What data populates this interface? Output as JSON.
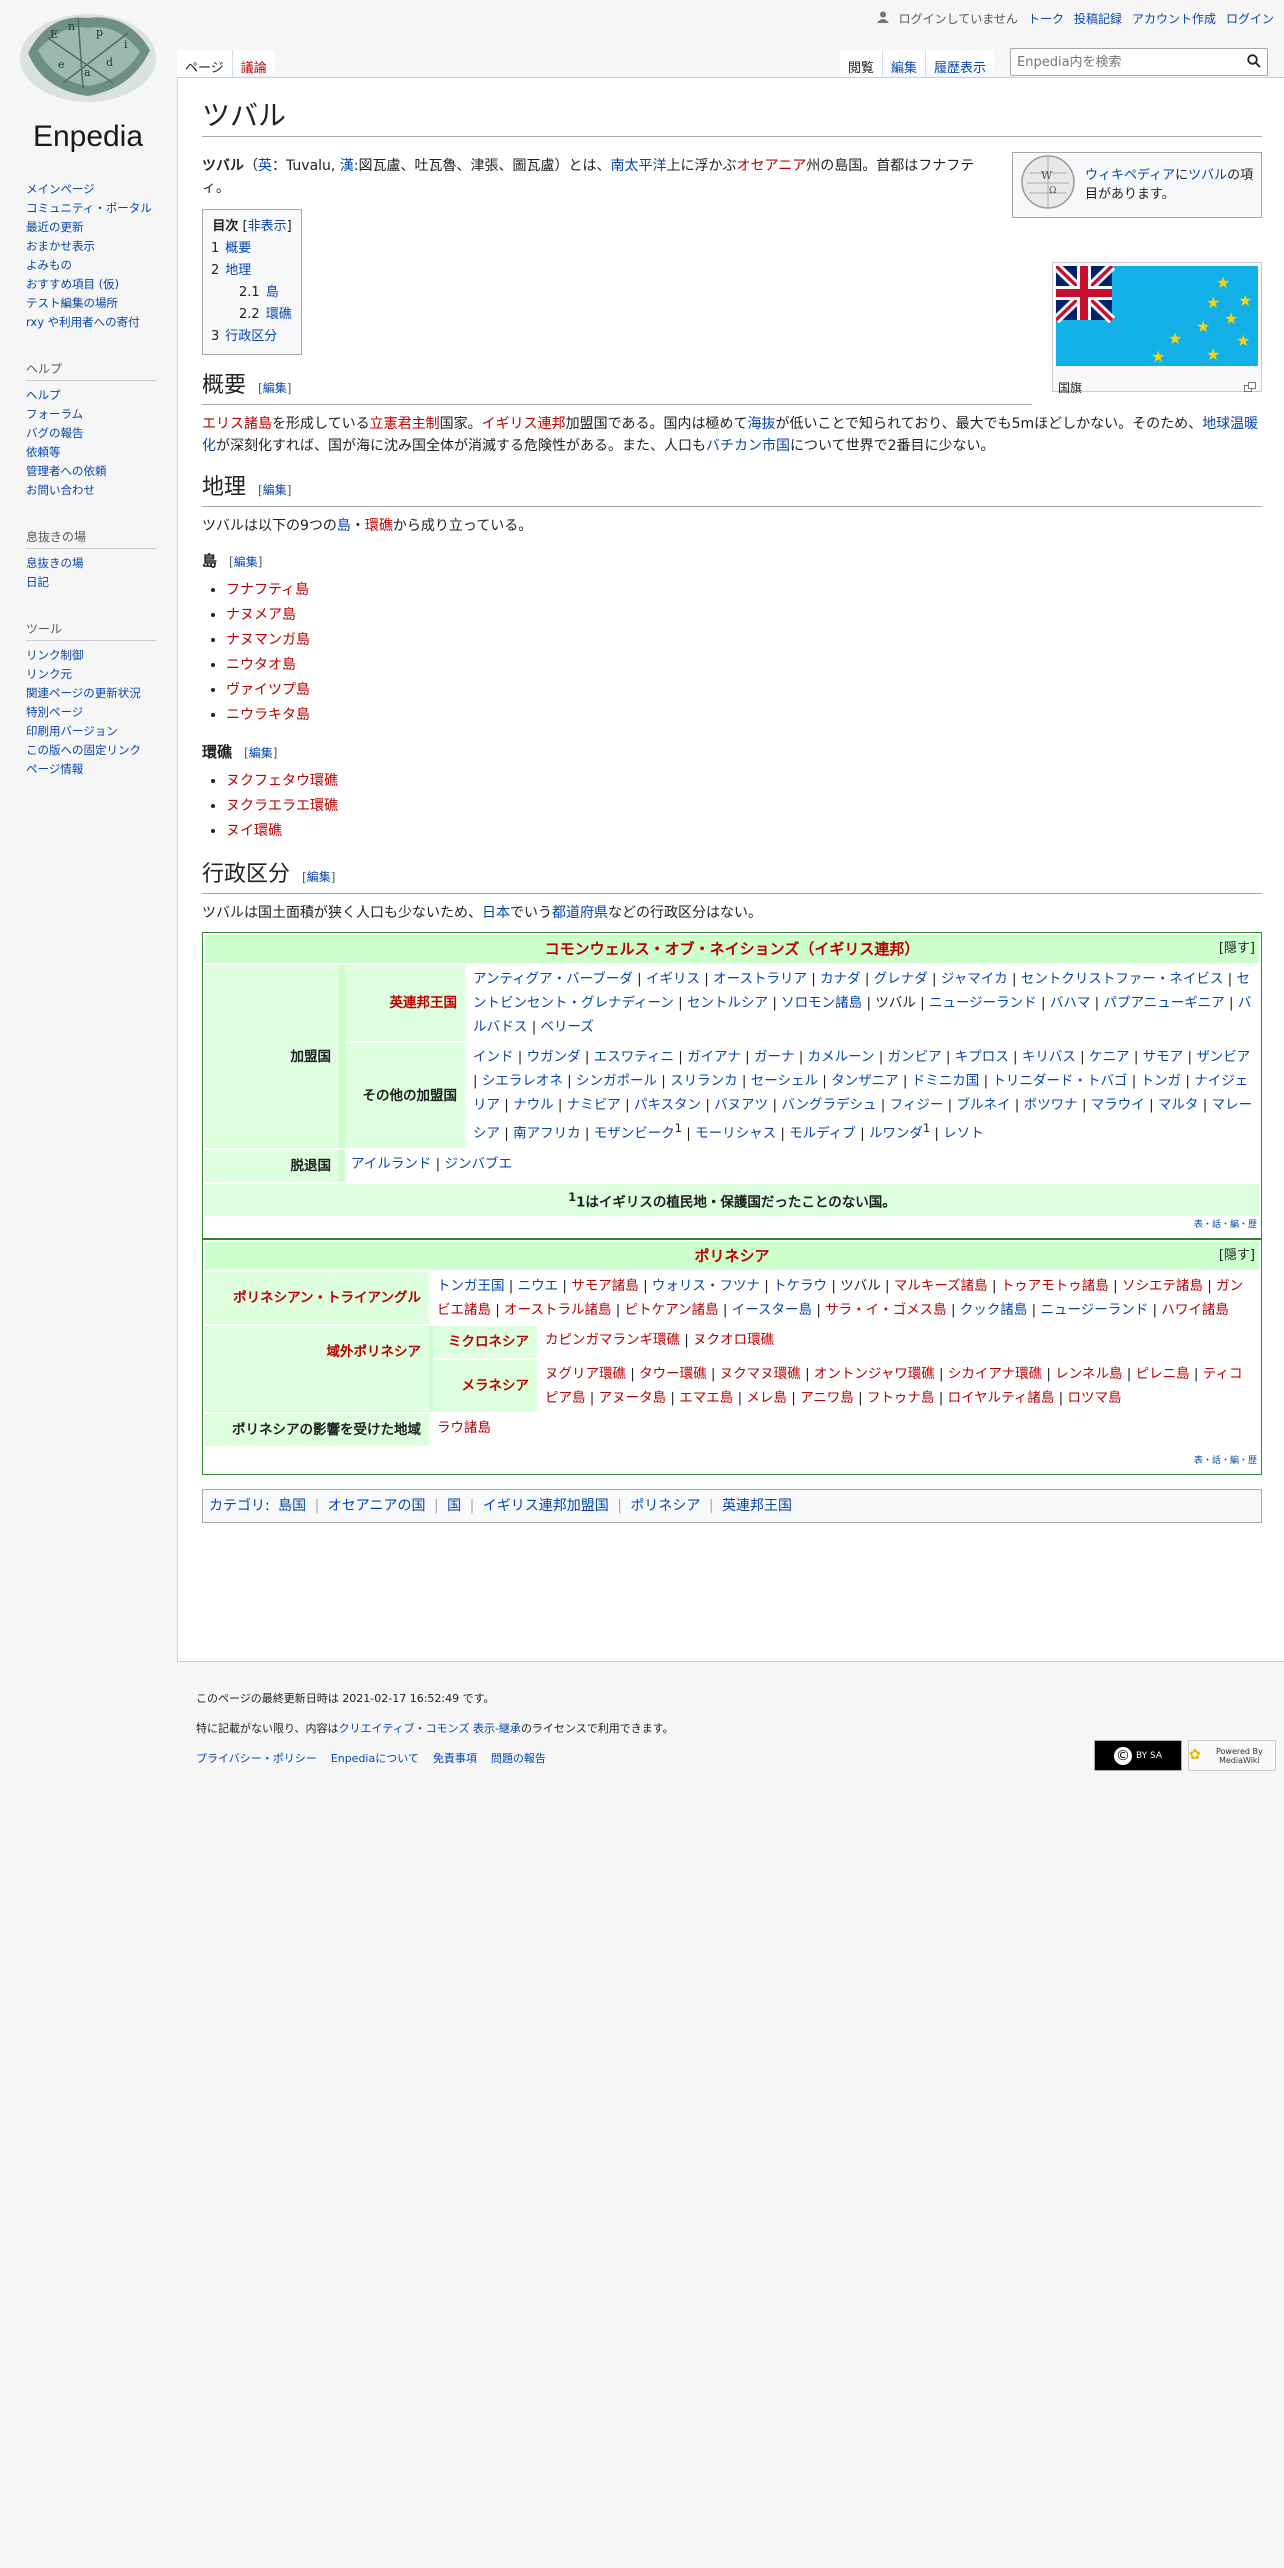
{
  "site": {
    "logo_text": "Enpedia",
    "logo_leaf_letters": [
      "E",
      "n",
      "p",
      "e",
      "d",
      "i",
      "a"
    ]
  },
  "personal": {
    "not_logged_in": "ログインしていません",
    "talk": "トーク",
    "contribs": "投稿記録",
    "create_account": "アカウント作成",
    "login": "ログイン"
  },
  "tabs": {
    "page": "ページ",
    "discussion": "議論",
    "read": "閲覧",
    "edit": "編集",
    "history": "履歴表示"
  },
  "search": {
    "placeholder": "Enpedia内を検索"
  },
  "sidebar": {
    "main": [
      "メインページ",
      "コミュニティ・ポータル",
      "最近の更新",
      "おまかせ表示",
      "よみもの",
      "おすすめ項目 (仮)",
      "テスト編集の場所",
      "rxy や利用者への寄付"
    ],
    "help_title": "ヘルプ",
    "help": [
      "ヘルプ",
      "フォーラム",
      "バグの報告",
      "依頼等",
      "管理者への依頼",
      "お問い合わせ"
    ],
    "rest_title": "息抜きの場",
    "rest": [
      "息抜きの場",
      "日記"
    ],
    "tools_title": "ツール",
    "tools": [
      "リンク元",
      "関連ページの更新状況",
      "特別ページ",
      "印刷用バージョン",
      "この版への固定リンク",
      "ページ情報"
    ],
    "tools_first": "リンク制御"
  },
  "article": {
    "title": "ツバル",
    "wp_box": {
      "pre": "",
      "link1": "ウィキペディア",
      "mid": "に",
      "link2": "ツバル",
      "post": "の項目があります。"
    },
    "flag_caption": "国旗",
    "intro": {
      "bold": "ツバル",
      "p1": "（",
      "en": "英",
      "p2": "：Tuvalu, ",
      "han": "漢",
      "p3": ":図瓦盧、吐瓦魯、津張、圖瓦盧）とは、",
      "pacific": "南太平洋",
      "p4": "上に浮かぶ",
      "oceania": "オセアニア",
      "p5": "州の島国。首都はフナフティ。"
    },
    "toc": {
      "title": "目次",
      "toggle": "非表示",
      "items": [
        {
          "num": "1",
          "label": "概要"
        },
        {
          "num": "2",
          "label": "地理"
        },
        {
          "num": "2.1",
          "label": "島"
        },
        {
          "num": "2.2",
          "label": "環礁"
        },
        {
          "num": "3",
          "label": "行政区分"
        }
      ]
    },
    "edit_label": "編集",
    "s1": {
      "heading": "概要",
      "t1": "エリス諸島",
      "t2": "を形成している",
      "t3": "立憲君主制",
      "t4": "国家。",
      "t5": "イギリス連邦",
      "t6": "加盟国である。国内は極めて",
      "t7": "海抜",
      "t8": "が低いことで知られており、最大でも5mほどしかない。そのため、",
      "t9": "地球温暖化",
      "t10": "が深刻化すれば、国が海に沈み国全体が消滅する危険性がある。また、人口も",
      "t11": "バチカン市国",
      "t12": "について世界で2番目に少ない。"
    },
    "s2": {
      "heading": "地理",
      "t1": "ツバルは以下の9つの",
      "t2": "島",
      "t3": "・",
      "t4": "環礁",
      "t5": "から成り立っている。"
    },
    "islands": {
      "heading": "島",
      "items": [
        "フナフティ島",
        "ナヌメア島",
        "ナヌマンガ島",
        "ニウタオ島",
        "ヴァイツプ島",
        "ニウラキタ島"
      ]
    },
    "atolls": {
      "heading": "環礁",
      "items": [
        "ヌクフェタウ環礁",
        "ヌクラエラエ環礁",
        "ヌイ環礁"
      ]
    },
    "s3": {
      "heading": "行政区分",
      "t1": "ツバルは国土面積が狭く人口も少ないため、",
      "t2": "日本",
      "t3": "でいう",
      "t4": "都道府県",
      "t5": "などの行政区分はない。"
    }
  },
  "navbox1": {
    "title": "コモンウェルス・オブ・ネイションズ（イギリス連邦）",
    "hide": "[隠す]",
    "member_label": "加盟国",
    "realm_label": "英連邦王国",
    "realms": [
      [
        "アンティグア・バーブーダ",
        "b"
      ],
      [
        "イギリス",
        "b"
      ],
      [
        "オーストラリア",
        "b"
      ],
      [
        "カナダ",
        "b"
      ],
      [
        "グレナダ",
        "b"
      ],
      [
        "ジャマイカ",
        "b"
      ],
      [
        "セントクリストファー・ネイビス",
        "b"
      ],
      [
        "セントビンセント・グレナディーン",
        "b"
      ],
      [
        "セントルシア",
        "b"
      ],
      [
        "ソロモン諸島",
        "b"
      ],
      [
        "ツバル",
        "p"
      ],
      [
        "ニュージーランド",
        "b"
      ],
      [
        "バハマ",
        "b"
      ],
      [
        "パプアニューギニア",
        "b"
      ],
      [
        "バルバドス",
        "b"
      ],
      [
        "ベリーズ",
        "b"
      ]
    ],
    "others_label": "その他の加盟国",
    "others": [
      [
        "インド",
        "b"
      ],
      [
        "ウガンダ",
        "b"
      ],
      [
        "エスワティニ",
        "b"
      ],
      [
        "ガイアナ",
        "b"
      ],
      [
        "ガーナ",
        "b"
      ],
      [
        "カメルーン",
        "b"
      ],
      [
        "ガンビア",
        "b"
      ],
      [
        "キプロス",
        "b"
      ],
      [
        "キリバス",
        "b"
      ],
      [
        "ケニア",
        "b"
      ],
      [
        "サモア",
        "b"
      ],
      [
        "ザンビア",
        "b"
      ],
      [
        "シエラレオネ",
        "b"
      ],
      [
        "シンガポール",
        "b"
      ],
      [
        "スリランカ",
        "b"
      ],
      [
        "セーシェル",
        "b"
      ],
      [
        "タンザニア",
        "b"
      ],
      [
        "ドミニカ国",
        "b"
      ],
      [
        "トリニダード・トバゴ",
        "b"
      ],
      [
        "トンガ",
        "b"
      ],
      [
        "ナイジェリア",
        "b"
      ],
      [
        "ナウル",
        "b"
      ],
      [
        "ナミビア",
        "b"
      ],
      [
        "パキスタン",
        "b"
      ],
      [
        "バヌアツ",
        "b"
      ],
      [
        "バングラデシュ",
        "b"
      ],
      [
        "フィジー",
        "b"
      ],
      [
        "ブルネイ",
        "b"
      ],
      [
        "ボツワナ",
        "b"
      ],
      [
        "マラウイ",
        "b"
      ],
      [
        "マルタ",
        "b"
      ],
      [
        "マレーシア",
        "b"
      ],
      [
        "南アフリカ",
        "b"
      ],
      [
        "モザンビーク",
        "b",
        "1"
      ],
      [
        "モーリシャス",
        "b"
      ],
      [
        "モルディブ",
        "b"
      ],
      [
        "ルワンダ",
        "b",
        "1"
      ],
      [
        "レソト",
        "b"
      ]
    ],
    "withdrawn_label": "脱退国",
    "withdrawn": [
      [
        "アイルランド",
        "b"
      ],
      [
        "ジンバブエ",
        "b"
      ]
    ],
    "footnote": "1はイギリスの植民地・保護国だったことのない国。",
    "footnote_sup": "1",
    "vte": "表・話・編・歴"
  },
  "navbox2": {
    "title": "ポリネシア",
    "hide": "[隠す]",
    "tri_label": "ポリネシアン・トライアングル",
    "tri": [
      [
        "トンガ王国",
        "b"
      ],
      [
        "ニウエ",
        "b"
      ],
      [
        "サモア諸島",
        "r"
      ],
      [
        "ウォリス・フツナ",
        "b"
      ],
      [
        "トケラウ",
        "b"
      ],
      [
        "ツバル",
        "p"
      ],
      [
        "マルキーズ諸島",
        "r"
      ],
      [
        "トゥアモトゥ諸島",
        "r"
      ],
      [
        "ソシエテ諸島",
        "r"
      ],
      [
        "ガンビエ諸島",
        "r"
      ],
      [
        "オーストラル諸島",
        "r"
      ],
      [
        "ピトケアン諸島",
        "r"
      ],
      [
        "イースター島",
        "b"
      ],
      [
        "サラ・イ・ゴメス島",
        "r"
      ],
      [
        "クック諸島",
        "b"
      ],
      [
        "ニュージーランド",
        "b"
      ],
      [
        "ハワイ諸島",
        "r"
      ]
    ],
    "outer_label": "域外ポリネシア",
    "micro_label": "ミクロネシア",
    "micro": [
      [
        "カピンガマランギ環礁",
        "r"
      ],
      [
        "ヌクオロ環礁",
        "r"
      ]
    ],
    "mela_label": "メラネシア",
    "mela": [
      [
        "ヌグリア環礁",
        "r"
      ],
      [
        "タウー環礁",
        "r"
      ],
      [
        "ヌクマヌ環礁",
        "r"
      ],
      [
        "オントンジャワ環礁",
        "r"
      ],
      [
        "シカイアナ環礁",
        "r"
      ],
      [
        "レンネル島",
        "r"
      ],
      [
        "ピレニ島",
        "r"
      ],
      [
        "ティコピア島",
        "r"
      ],
      [
        "アヌータ島",
        "r"
      ],
      [
        "エマエ島",
        "r"
      ],
      [
        "メレ島",
        "r"
      ],
      [
        "アニワ島",
        "r"
      ],
      [
        "フトゥナ島",
        "r"
      ],
      [
        "ロイヤルティ諸島",
        "r"
      ],
      [
        "ロツマ島",
        "r"
      ]
    ],
    "infl_label": "ポリネシアの影響を受けた地域",
    "infl": [
      [
        "ラウ諸島",
        "r"
      ]
    ],
    "vte": "表・話・編・歴"
  },
  "categories": {
    "label": "カテゴリ",
    "items": [
      "島国",
      "オセアニアの国",
      "国",
      "イギリス連邦加盟国",
      "ポリネシア",
      "英連邦王国"
    ]
  },
  "footer": {
    "lastmod": "このページの最終更新日時は 2021-02-17 16:52:49 です。",
    "license_pre": "特に記載がない限り、内容は",
    "license_link": "クリエイティブ・コモンズ 表示-継承",
    "license_post": "のライセンスで利用できます。",
    "links": [
      "プライバシー・ポリシー",
      "Enpediaについて",
      "免責事項",
      "問題の報告"
    ],
    "cc_badge": "BY SA",
    "mw_badge": "Powered By MediaWiki"
  },
  "colors": {
    "link": "#0645ad",
    "redlink": "#ba0000",
    "navbox_head": "#ccffcc",
    "navbox_group": "#ddffdd"
  }
}
